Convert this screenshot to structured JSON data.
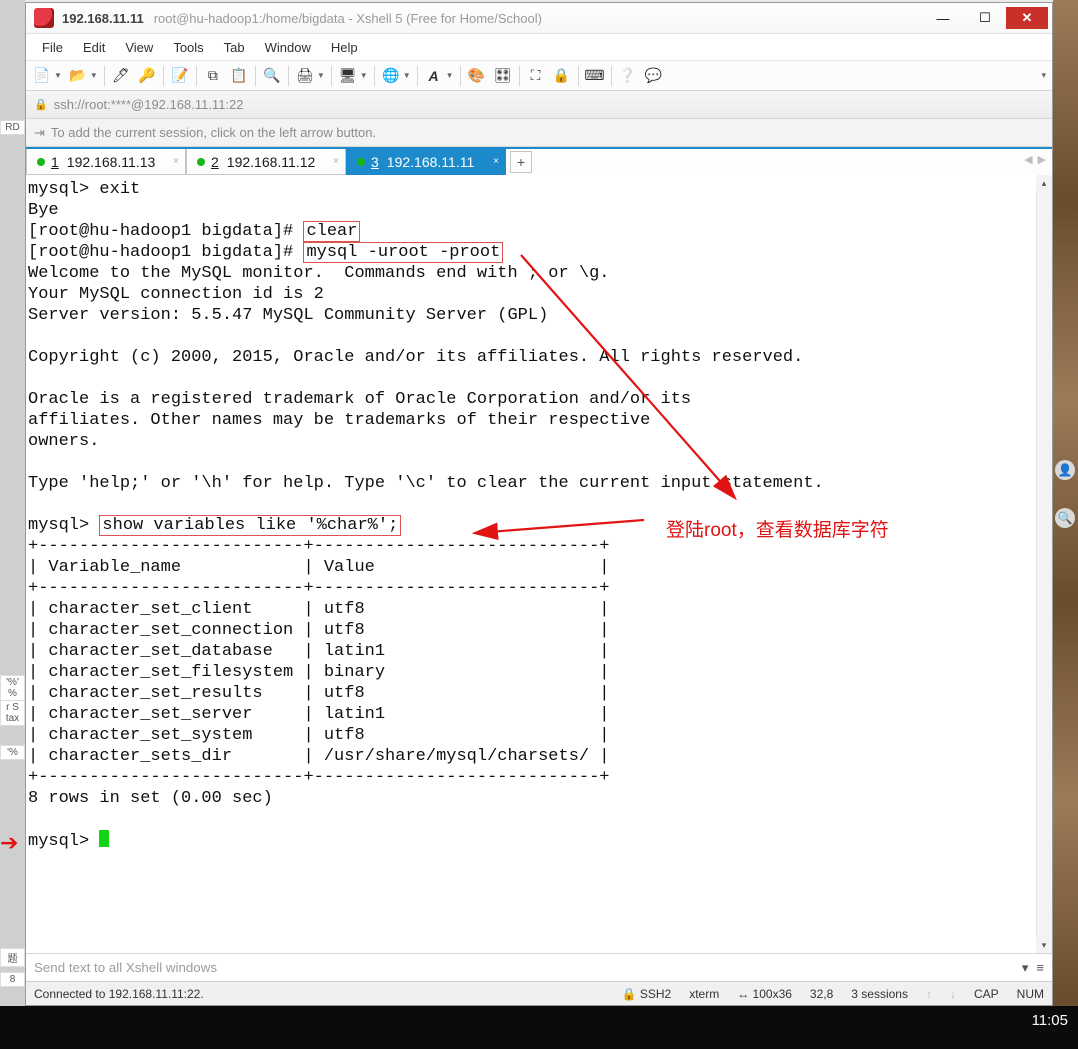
{
  "window": {
    "title_main": "192.168.11.11",
    "title_sub": "root@hu-hadoop1:/home/bigdata - Xshell 5 (Free for Home/School)"
  },
  "menu": {
    "file": "File",
    "edit": "Edit",
    "view": "View",
    "tools": "Tools",
    "tab": "Tab",
    "window": "Window",
    "help": "Help"
  },
  "address": "ssh://root:****@192.168.11.11:22",
  "hint": "To add the current session, click on the left arrow button.",
  "tabs": [
    {
      "num": "1",
      "label": "192.168.11.13"
    },
    {
      "num": "2",
      "label": "192.168.11.12"
    },
    {
      "num": "3",
      "label": "192.168.11.11"
    }
  ],
  "compose": {
    "placeholder": "Send text to all Xshell windows"
  },
  "status": {
    "connected": "Connected to 192.168.11.11:22.",
    "proto": "SSH2",
    "termtype": "xterm",
    "size": "100x36",
    "cursor": "32,8",
    "sessions": "3 sessions",
    "cap": "CAP",
    "num": "NUM"
  },
  "terminal": {
    "l1": "mysql> exit",
    "l2": "Bye",
    "l3a": "[root@hu-hadoop1 bigdata]# ",
    "l3b": "clear",
    "l4a": "[root@hu-hadoop1 bigdata]# ",
    "l4b": "mysql -uroot -proot",
    "l5": "Welcome to the MySQL monitor.  Commands end with ; or \\g.",
    "l6": "Your MySQL connection id is 2",
    "l7": "Server version: 5.5.47 MySQL Community Server (GPL)",
    "l8": "Copyright (c) 2000, 2015, Oracle and/or its affiliates. All rights reserved.",
    "l9": "Oracle is a registered trademark of Oracle Corporation and/or its",
    "l10": "affiliates. Other names may be trademarks of their respective",
    "l11": "owners.",
    "l12": "Type 'help;' or '\\h' for help. Type '\\c' to clear the current input statement.",
    "l13a": "mysql> ",
    "l13b": "show variables like '%char%';",
    "sep": "+--------------------------+----------------------------+",
    "hd": "| Variable_name            | Value                      |",
    "r1": "| character_set_client     | utf8                       |",
    "r2": "| character_set_connection | utf8                       |",
    "r3": "| character_set_database   | latin1                     |",
    "r4": "| character_set_filesystem | binary                     |",
    "r5": "| character_set_results    | utf8                       |",
    "r6": "| character_set_server     | latin1                     |",
    "r7": "| character_set_system     | utf8                       |",
    "r8": "| character_sets_dir       | /usr/share/mysql/charsets/ |",
    "sum": "8 rows in set (0.00 sec)",
    "p": "mysql> "
  },
  "annotation": "登陆root，查看数据库字符",
  "toolbar_icons": {
    "new": "📄",
    "open": "📂",
    "props": "🖊",
    "keygen": "🔑",
    "script": "📝",
    "copy": "⧉",
    "paste": "📋",
    "find": "🔍",
    "print": "🖨",
    "transfer": "🖥",
    "globe": "🌐",
    "font": "A",
    "color": "🎨",
    "palette": "🎛",
    "full": "⛶",
    "lock": "🔒",
    "keyboard": "⌨",
    "help": "❔",
    "chat": "💬"
  },
  "desk": {
    "frag1": "'%' %",
    "frag2": "r S\ntax",
    "frag3": "'%",
    "frag4": "RD",
    "frag5": "题",
    "frag6": "8"
  },
  "clock": "11:05"
}
